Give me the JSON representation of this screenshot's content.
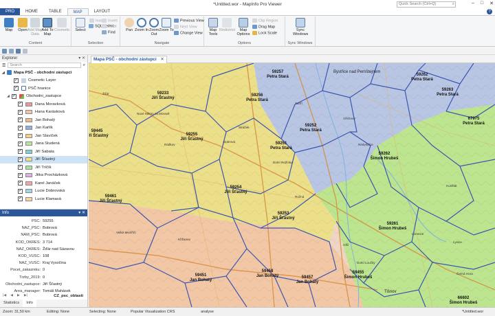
{
  "window": {
    "title": "*Untitled.wor - MapInfo Pro Viewer",
    "search_placeholder": "Quick Search (Ctrl+Q)"
  },
  "tabs": [
    "PRO",
    "HOME",
    "TABLE",
    "MAP",
    "LAYOUT"
  ],
  "ribbon": {
    "content": {
      "group": "Content",
      "map": "Map",
      "open": "Open",
      "add_map": "Add Map Data",
      "add_to_map": "Add To Map",
      "cosmetic": "Cosmetic"
    },
    "selection": {
      "group": "Selection",
      "select": "Select",
      "sql": "SQL Select",
      "find": "Find",
      "invert": "Invert",
      "clear": "Clear",
      "insert": "Insert"
    },
    "navigate": {
      "group": "Navigate",
      "pan": "Pan",
      "zoom_in": "Zoom In",
      "zoom_out": "Zoom Out",
      "zoom_to": "Zoom To",
      "previous_view": "Previous View",
      "next_view": "Next View",
      "change_view": "Change View"
    },
    "options": {
      "group": "Options",
      "map_tools": "Map Tools",
      "redistrict": "Redistrict",
      "map_options": "Map Options",
      "clip_region": "Clip Region",
      "drag_map": "Drag Map",
      "lock_scale": "Lock Scale"
    },
    "sync": {
      "group": "Sync Windows",
      "sync_windows": "Sync Windows"
    }
  },
  "explorer": {
    "title": "Explorer",
    "search_placeholder": "Search",
    "map_name": "Mapa PSČ - obchodní zástupci",
    "layers": [
      {
        "name": "Cosmetic Layer"
      },
      {
        "name": "PSČ hranice"
      },
      {
        "name": "Obchodni_zastupce"
      }
    ],
    "agents": [
      {
        "name": "Dana Moravková",
        "color": "#e79a9a"
      },
      {
        "name": "Hana Karásková",
        "color": "#f0c5a8"
      },
      {
        "name": "Jan Bohatý",
        "color": "#f3b98e"
      },
      {
        "name": "Jan Karlík",
        "color": "#8fb0dc"
      },
      {
        "name": "Jan Slavíček",
        "color": "#f7d08c"
      },
      {
        "name": "Jana Studená",
        "color": "#bfe59a"
      },
      {
        "name": "Jiří Sabata",
        "color": "#7ecfd8"
      },
      {
        "name": "Jiří Šťastný",
        "color": "#efe38a"
      },
      {
        "name": "Jiří Tríčík",
        "color": "#a9e29f"
      },
      {
        "name": "Jitka Procházková",
        "color": "#d9b3e3"
      },
      {
        "name": "Karel Janáček",
        "color": "#f2a8a8"
      },
      {
        "name": "Lucie Dobrovská",
        "color": "#9ed7ea"
      },
      {
        "name": "Lucie Klamavá",
        "color": "#f7d6a3"
      }
    ]
  },
  "info": {
    "title": "Info",
    "rows": [
      {
        "k": "PSC:",
        "v": "59255"
      },
      {
        "k": "NAZ_PSC:",
        "v": "Bobrová"
      },
      {
        "k": "NAM_PSC:",
        "v": "Bobrová"
      },
      {
        "k": "KOD_OKRES:",
        "v": "3 714"
      },
      {
        "k": "NAZ_OKRES:",
        "v": "Žďár nad Sázavou"
      },
      {
        "k": "KOD_VUSC:",
        "v": "108"
      },
      {
        "k": "NAZ_VUSC:",
        "v": "Kraj Vysočina"
      },
      {
        "k": "Pocet_zakazniku:",
        "v": "0"
      },
      {
        "k": "Trzby_2019:",
        "v": "0"
      },
      {
        "k": "Obchodni_zastupce:",
        "v": "Jiří Šťastný"
      },
      {
        "k": "Area_manager:",
        "v": "Tomáš Mahásek"
      }
    ],
    "layer": "CZ_psc_oblasti",
    "bottom_tabs": [
      "Statistics",
      "Info"
    ]
  },
  "map_window": {
    "tab": "Mapa PSČ - obchodní zástupci",
    "labels": [
      {
        "psc": "59257",
        "agent": "Petra Stará"
      },
      {
        "psc": "59233",
        "agent": "Jiří Šťastný"
      },
      {
        "psc": "59256",
        "agent": "Petra Stará"
      },
      {
        "psc": "59262",
        "agent": "Petra Stará"
      },
      {
        "psc": "59263",
        "agent": "Petra Stará"
      },
      {
        "psc": "59445",
        "agent": "Jiří Šťastný"
      },
      {
        "psc": "59255",
        "agent": "Jiří Šťastný"
      },
      {
        "psc": "59252",
        "agent": "Petra Stará"
      },
      {
        "psc": "67975",
        "agent": "Petra Stará"
      },
      {
        "psc": "59251",
        "agent": "Petra Stará"
      },
      {
        "psc": "59262",
        "agent": "Šimon Hrubeš"
      },
      {
        "psc": "59254",
        "agent": "Jiří Šťastný"
      },
      {
        "psc": "59461",
        "agent": "Jiří Šťastný"
      },
      {
        "psc": "59253",
        "agent": "Jiří Šťastný"
      },
      {
        "psc": "59261",
        "agent": "Šimon Hrubeš"
      },
      {
        "psc": "59451",
        "agent": "Jan Bohatý"
      },
      {
        "psc": "59458",
        "agent": "Jan Bohatý"
      },
      {
        "psc": "59457",
        "agent": "Jan Bohatý"
      },
      {
        "psc": "59455",
        "agent": "Šimon Hrubeš"
      },
      {
        "psc": "66602",
        "agent": "Šimon Hrubeš"
      }
    ],
    "places": [
      "Bystřice nad Pernštejnem",
      "Nové Město na Moravě",
      "Žďár",
      "Dolní Rožínka",
      "Bobrová",
      "Radkov",
      "Strážek",
      "Nedvědice",
      "Tišnov",
      "Křižanov",
      "Velké Meziříčí",
      "Rožná",
      "Kunštát",
      "Olší",
      "Dolní Loučky",
      "Lomnice",
      "Lysice",
      "Černá Hora",
      "Zubří",
      "Věchnov"
    ]
  },
  "status": {
    "zoom": "Zoom: 31,50 km",
    "editing": "Editing: None",
    "selecting": "Selecting: None",
    "crs": "Popular Visualization CRS",
    "analyse": "analyse",
    "workspace": "*Untitled.wor"
  }
}
